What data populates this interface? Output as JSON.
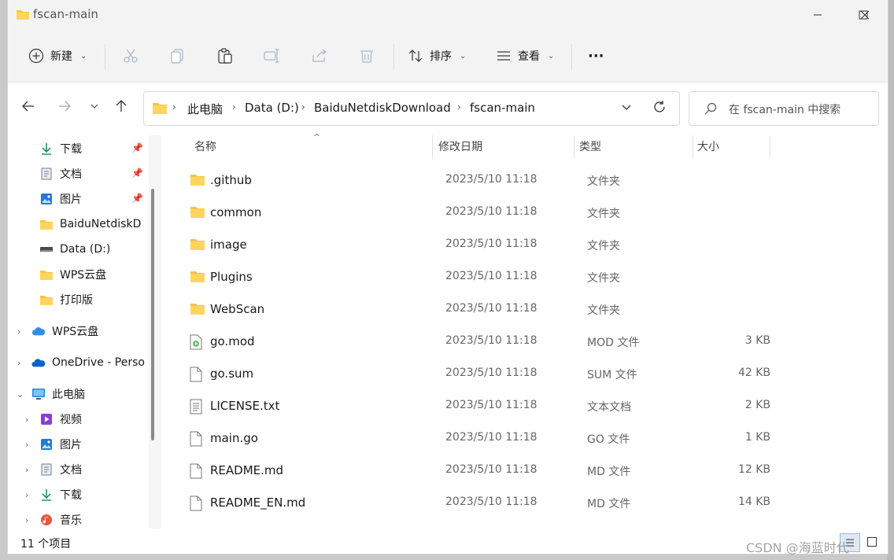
{
  "window": {
    "title": "fscan-main"
  },
  "toolbar": {
    "new_label": "新建",
    "sort_label": "排序",
    "view_label": "查看",
    "more_label": "···"
  },
  "address": {
    "crumbs": [
      "此电脑",
      "Data (D:)",
      "BaiduNetdiskDownload",
      "fscan-main"
    ]
  },
  "search": {
    "placeholder": "在 fscan-main 中搜索"
  },
  "sidebar": {
    "quick": [
      {
        "label": "下载",
        "icon": "download-icon",
        "pinned": true
      },
      {
        "label": "文档",
        "icon": "document-icon",
        "pinned": true
      },
      {
        "label": "图片",
        "icon": "picture-icon",
        "pinned": true
      },
      {
        "label": "BaiduNetdiskD",
        "icon": "folder-icon",
        "pinned": false
      },
      {
        "label": "Data (D:)",
        "icon": "drive-icon",
        "pinned": false
      },
      {
        "label": "WPS云盘",
        "icon": "folder-icon",
        "pinned": false
      },
      {
        "label": "打印版",
        "icon": "folder-icon",
        "pinned": false
      }
    ],
    "roots": [
      {
        "label": "WPS云盘",
        "icon": "cloud-icon",
        "expanded": false
      },
      {
        "label": "OneDrive - Perso",
        "icon": "onedrive-icon",
        "expanded": false
      },
      {
        "label": "此电脑",
        "icon": "computer-icon",
        "expanded": true
      }
    ],
    "pc_children": [
      {
        "label": "视频",
        "icon": "video-icon"
      },
      {
        "label": "图片",
        "icon": "picture-icon"
      },
      {
        "label": "文档",
        "icon": "document-icon"
      },
      {
        "label": "下载",
        "icon": "download-icon"
      },
      {
        "label": "音乐",
        "icon": "music-icon"
      }
    ]
  },
  "columns": {
    "name": "名称",
    "date": "修改日期",
    "type": "类型",
    "size": "大小"
  },
  "files": [
    {
      "name": ".github",
      "date": "2023/5/10 11:18",
      "type": "文件夹",
      "size": "",
      "icon": "folder-icon"
    },
    {
      "name": "common",
      "date": "2023/5/10 11:18",
      "type": "文件夹",
      "size": "",
      "icon": "folder-icon"
    },
    {
      "name": "image",
      "date": "2023/5/10 11:18",
      "type": "文件夹",
      "size": "",
      "icon": "folder-icon"
    },
    {
      "name": "Plugins",
      "date": "2023/5/10 11:18",
      "type": "文件夹",
      "size": "",
      "icon": "folder-icon"
    },
    {
      "name": "WebScan",
      "date": "2023/5/10 11:18",
      "type": "文件夹",
      "size": "",
      "icon": "folder-icon"
    },
    {
      "name": "go.mod",
      "date": "2023/5/10 11:18",
      "type": "MOD 文件",
      "size": "3 KB",
      "icon": "media-file-icon"
    },
    {
      "name": "go.sum",
      "date": "2023/5/10 11:18",
      "type": "SUM 文件",
      "size": "42 KB",
      "icon": "file-icon"
    },
    {
      "name": "LICENSE.txt",
      "date": "2023/5/10 11:18",
      "type": "文本文档",
      "size": "2 KB",
      "icon": "text-file-icon"
    },
    {
      "name": "main.go",
      "date": "2023/5/10 11:18",
      "type": "GO 文件",
      "size": "1 KB",
      "icon": "file-icon"
    },
    {
      "name": "README.md",
      "date": "2023/5/10 11:18",
      "type": "MD 文件",
      "size": "12 KB",
      "icon": "file-icon"
    },
    {
      "name": "README_EN.md",
      "date": "2023/5/10 11:18",
      "type": "MD 文件",
      "size": "14 KB",
      "icon": "file-icon"
    }
  ],
  "status": {
    "count": "11 个项目"
  },
  "watermark": "CSDN @海蓝时代"
}
